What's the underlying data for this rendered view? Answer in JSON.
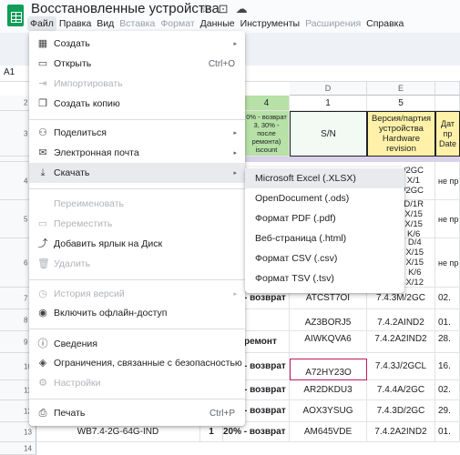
{
  "window": {
    "title": "Восстановленные устройства",
    "menubar": [
      {
        "label": "Файл",
        "state": "active"
      },
      {
        "label": "Правка",
        "state": "normal"
      },
      {
        "label": "Вид",
        "state": "normal"
      },
      {
        "label": "Вставка",
        "state": "disabled"
      },
      {
        "label": "Формат",
        "state": "disabled"
      },
      {
        "label": "Данные",
        "state": "normal"
      },
      {
        "label": "Инструменты",
        "state": "normal"
      },
      {
        "label": "Расширения",
        "state": "disabled"
      },
      {
        "label": "Справка",
        "state": "normal"
      }
    ]
  },
  "sheet": {
    "namebox": "A1",
    "columns": [
      "D",
      "E"
    ],
    "rows": [
      "2",
      "3",
      "4",
      "5",
      "6",
      "7",
      "8",
      "9",
      "10",
      "11",
      "12",
      "13",
      "14"
    ],
    "header_cells": {
      "c_num": "4",
      "d_num": "1",
      "e_num": "5",
      "c_hdr": "0% - возврат 3, 30% - после ремонта) iscount",
      "d_hdr": "S/N",
      "e_hdr": "Версия/партия устройства Hardware revision",
      "f_hdr": "Дат пр Date"
    },
    "partial_cells": {
      "e_row5a": "/2GC",
      "e_row5b": "X/1",
      "e_row5c": "/2GC",
      "e_row6a": "D/1R",
      "e_row6b": "X/15",
      "e_row6c": "X/15",
      "e_row6d": "K/6",
      "e_row7a": "D/4",
      "e_row7b": "X/15",
      "e_row7c": "X/15",
      "e_row7d": "K/6",
      "e_row7e": "X/12",
      "f_row5": "не при",
      "f_row6": "не при",
      "f_row7": "не при"
    },
    "data_rows": [
      {
        "c": "- возврат",
        "d": "ATCST7OI",
        "e": "7.4.3M/2GC",
        "f": "02."
      },
      {
        "c": "",
        "d": "AZ3BORJ5",
        "e": "7.4.2AIND2",
        "f": "01."
      },
      {
        "c": "ремонт",
        "d": "AIWKQVA6",
        "e": "7.4.2A2IND2",
        "f": "28."
      },
      {
        "c": "- возврат",
        "d": "A72HY23O",
        "e": "7.4.3J/2GCL",
        "f": "16."
      },
      {
        "c": "- возврат",
        "d": "AR2DKDU3",
        "e": "7.4.4A/2GC",
        "f": "02."
      },
      {
        "c": "- возврат",
        "d": "AOX3YSUG",
        "e": "7.4.3D/2GC",
        "f": "29."
      },
      {
        "c": "20% - возврат",
        "d": "AM645VDE",
        "e": "7.4.2A2IND2",
        "f": "01."
      }
    ],
    "row14": {
      "b": "WB7.4-2G-64G-IND",
      "c_num": "1"
    }
  },
  "file_menu": {
    "items": [
      {
        "label": "Создать",
        "icon": "plus-grid-icon",
        "glyph": "▦",
        "shortcut": "",
        "submenu": true,
        "disabled": false
      },
      {
        "label": "Открыть",
        "icon": "folder-icon",
        "glyph": "▭",
        "shortcut": "Ctrl+O",
        "submenu": false,
        "disabled": false
      },
      {
        "label": "Импортировать",
        "icon": "import-icon",
        "glyph": "⇥",
        "shortcut": "",
        "submenu": false,
        "disabled": true
      },
      {
        "label": "Создать копию",
        "icon": "copy-icon",
        "glyph": "❐",
        "shortcut": "",
        "submenu": false,
        "disabled": false
      },
      {
        "label": "Поделиться",
        "icon": "person-add-icon",
        "glyph": "⚇",
        "shortcut": "",
        "submenu": true,
        "disabled": false
      },
      {
        "label": "Электронная почта",
        "icon": "mail-icon",
        "glyph": "✉",
        "shortcut": "",
        "submenu": true,
        "disabled": false
      },
      {
        "label": "Скачать",
        "icon": "download-icon",
        "glyph": "⤓",
        "shortcut": "",
        "submenu": true,
        "disabled": false
      },
      {
        "label": "Переименовать",
        "icon": "rename-icon",
        "glyph": "",
        "shortcut": "",
        "submenu": false,
        "disabled": true
      },
      {
        "label": "Переместить",
        "icon": "move-icon",
        "glyph": "▭",
        "shortcut": "",
        "submenu": false,
        "disabled": true
      },
      {
        "label": "Добавить ярлык на Диск",
        "icon": "drive-shortcut-icon",
        "glyph": "⤴",
        "shortcut": "",
        "submenu": false,
        "disabled": false
      },
      {
        "label": "Удалить",
        "icon": "trash-icon",
        "glyph": "🗑",
        "shortcut": "",
        "submenu": false,
        "disabled": true
      },
      {
        "label": "История версий",
        "icon": "history-icon",
        "glyph": "◷",
        "shortcut": "",
        "submenu": true,
        "disabled": true
      },
      {
        "label": "Включить офлайн-доступ",
        "icon": "offline-icon",
        "glyph": "◉",
        "shortcut": "",
        "submenu": false,
        "disabled": false
      },
      {
        "label": "Сведения",
        "icon": "info-icon",
        "glyph": "ⓘ",
        "shortcut": "",
        "submenu": false,
        "disabled": false
      },
      {
        "label": "Ограничения, связанные с безопасностью",
        "icon": "shield-icon",
        "glyph": "◈",
        "shortcut": "",
        "submenu": false,
        "disabled": false
      },
      {
        "label": "Настройки",
        "icon": "gear-icon",
        "glyph": "⚙",
        "shortcut": "",
        "submenu": false,
        "disabled": true
      },
      {
        "label": "Печать",
        "icon": "printer-icon",
        "glyph": "⎙",
        "shortcut": "Ctrl+P",
        "submenu": false,
        "disabled": false
      }
    ]
  },
  "download_submenu": {
    "items": [
      "Microsoft Excel (.XLSX)",
      "OpenDocument (.ods)",
      "Формат PDF (.pdf)",
      "Веб-страница (.html)",
      "Формат CSV (.csv)",
      "Формат TSV (.tsv)"
    ]
  }
}
